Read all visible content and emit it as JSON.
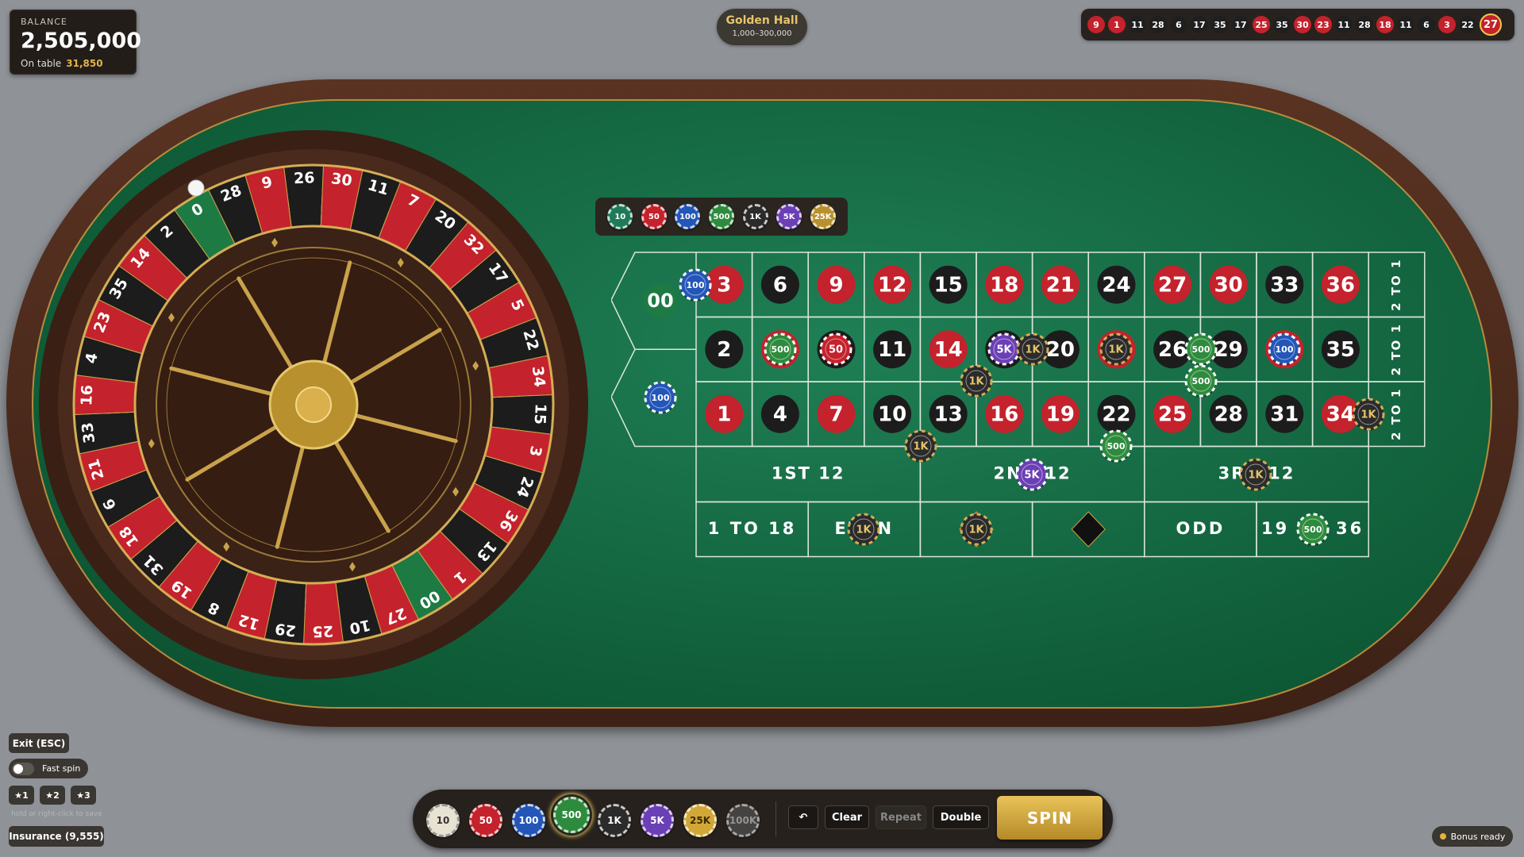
{
  "balance": {
    "label": "BALANCE",
    "amount": "2,505,000",
    "on_table_label": "On table",
    "on_table_value": "31,850"
  },
  "room": {
    "name": "Golden Hall",
    "limits": "1,000–300,000"
  },
  "history": [
    {
      "n": "9",
      "c": "red"
    },
    {
      "n": "1",
      "c": "red"
    },
    {
      "n": "11",
      "c": "black"
    },
    {
      "n": "28",
      "c": "black"
    },
    {
      "n": "6",
      "c": "black"
    },
    {
      "n": "17",
      "c": "black"
    },
    {
      "n": "35",
      "c": "black"
    },
    {
      "n": "17",
      "c": "black"
    },
    {
      "n": "25",
      "c": "red"
    },
    {
      "n": "35",
      "c": "black"
    },
    {
      "n": "30",
      "c": "red"
    },
    {
      "n": "23",
      "c": "red"
    },
    {
      "n": "11",
      "c": "black"
    },
    {
      "n": "28",
      "c": "black"
    },
    {
      "n": "18",
      "c": "red"
    },
    {
      "n": "11",
      "c": "black"
    },
    {
      "n": "6",
      "c": "black"
    },
    {
      "n": "3",
      "c": "red"
    },
    {
      "n": "22",
      "c": "black"
    },
    {
      "n": "27",
      "c": "red"
    }
  ],
  "wheel": {
    "pockets": [
      {
        "n": "0",
        "c": "green"
      },
      {
        "n": "28",
        "c": "black"
      },
      {
        "n": "9",
        "c": "red"
      },
      {
        "n": "26",
        "c": "black"
      },
      {
        "n": "30",
        "c": "red"
      },
      {
        "n": "11",
        "c": "black"
      },
      {
        "n": "7",
        "c": "red"
      },
      {
        "n": "20",
        "c": "black"
      },
      {
        "n": "32",
        "c": "red"
      },
      {
        "n": "17",
        "c": "black"
      },
      {
        "n": "5",
        "c": "red"
      },
      {
        "n": "22",
        "c": "black"
      },
      {
        "n": "34",
        "c": "red"
      },
      {
        "n": "15",
        "c": "black"
      },
      {
        "n": "3",
        "c": "red"
      },
      {
        "n": "24",
        "c": "black"
      },
      {
        "n": "36",
        "c": "red"
      },
      {
        "n": "13",
        "c": "black"
      },
      {
        "n": "1",
        "c": "red"
      },
      {
        "n": "00",
        "c": "green"
      },
      {
        "n": "27",
        "c": "red"
      },
      {
        "n": "10",
        "c": "black"
      },
      {
        "n": "25",
        "c": "red"
      },
      {
        "n": "29",
        "c": "black"
      },
      {
        "n": "12",
        "c": "red"
      },
      {
        "n": "8",
        "c": "black"
      },
      {
        "n": "19",
        "c": "red"
      },
      {
        "n": "31",
        "c": "black"
      },
      {
        "n": "18",
        "c": "red"
      },
      {
        "n": "6",
        "c": "black"
      },
      {
        "n": "21",
        "c": "red"
      },
      {
        "n": "33",
        "c": "black"
      },
      {
        "n": "16",
        "c": "red"
      },
      {
        "n": "4",
        "c": "black"
      },
      {
        "n": "23",
        "c": "red"
      },
      {
        "n": "35",
        "c": "black"
      },
      {
        "n": "14",
        "c": "red"
      },
      {
        "n": "2",
        "c": "black"
      }
    ]
  },
  "rack_chips": [
    {
      "label": "10",
      "color": "#1f7a5a"
    },
    {
      "label": "50",
      "color": "#c4222c"
    },
    {
      "label": "100",
      "color": "#2456b8"
    },
    {
      "label": "500",
      "color": "#2e8b3d"
    },
    {
      "label": "1K",
      "color": "#2b2b2b"
    },
    {
      "label": "5K",
      "color": "#6b3fb5"
    },
    {
      "label": "25K",
      "color": "#b8912e"
    }
  ],
  "board": {
    "zeros": [
      "00",
      "0"
    ],
    "rows": [
      [
        {
          "n": "3",
          "c": "red"
        },
        {
          "n": "6",
          "c": "black"
        },
        {
          "n": "9",
          "c": "red"
        },
        {
          "n": "12",
          "c": "red"
        },
        {
          "n": "15",
          "c": "black"
        },
        {
          "n": "18",
          "c": "red"
        },
        {
          "n": "21",
          "c": "red"
        },
        {
          "n": "24",
          "c": "black"
        },
        {
          "n": "27",
          "c": "red"
        },
        {
          "n": "30",
          "c": "red"
        },
        {
          "n": "33",
          "c": "black"
        },
        {
          "n": "36",
          "c": "red"
        }
      ],
      [
        {
          "n": "2",
          "c": "black"
        },
        {
          "n": "5",
          "c": "red"
        },
        {
          "n": "8",
          "c": "black"
        },
        {
          "n": "11",
          "c": "black"
        },
        {
          "n": "14",
          "c": "red"
        },
        {
          "n": "17",
          "c": "black"
        },
        {
          "n": "20",
          "c": "black"
        },
        {
          "n": "23",
          "c": "red"
        },
        {
          "n": "26",
          "c": "black"
        },
        {
          "n": "29",
          "c": "black"
        },
        {
          "n": "32",
          "c": "red"
        },
        {
          "n": "35",
          "c": "black"
        }
      ],
      [
        {
          "n": "1",
          "c": "red"
        },
        {
          "n": "4",
          "c": "black"
        },
        {
          "n": "7",
          "c": "red"
        },
        {
          "n": "10",
          "c": "black"
        },
        {
          "n": "13",
          "c": "black"
        },
        {
          "n": "16",
          "c": "red"
        },
        {
          "n": "19",
          "c": "red"
        },
        {
          "n": "22",
          "c": "black"
        },
        {
          "n": "25",
          "c": "red"
        },
        {
          "n": "28",
          "c": "black"
        },
        {
          "n": "31",
          "c": "black"
        },
        {
          "n": "34",
          "c": "red"
        }
      ]
    ],
    "column_bets": [
      "2 TO 1",
      "2 TO 1",
      "2 TO 1"
    ],
    "dozens": [
      "1ST 12",
      "2ND 12",
      "3RD 12"
    ],
    "outside": [
      "1 TO 18",
      "EVEN",
      "RED",
      "BLACK",
      "ODD",
      "19 TO 36"
    ]
  },
  "placed_chips": [
    {
      "id": "chip-00-top",
      "label": "100",
      "color": "#2456b8"
    },
    {
      "id": "chip-zero",
      "label": "100",
      "color": "#2456b8"
    },
    {
      "id": "chip-5",
      "label": "500",
      "color": "#2e8b3d"
    },
    {
      "id": "chip-8",
      "label": "50",
      "color": "#c4222c"
    },
    {
      "id": "chip-17",
      "label": "5K",
      "color": "#6b3fb5"
    },
    {
      "id": "chip-17-20",
      "label": "1K",
      "color": "#2b2b2b"
    },
    {
      "id": "chip-23",
      "label": "1K",
      "color": "#2b2b2b"
    },
    {
      "id": "chip-26-29",
      "label": "500",
      "color": "#2e8b3d"
    },
    {
      "id": "chip-32",
      "label": "100",
      "color": "#2456b8"
    },
    {
      "id": "chip-corner-13",
      "label": "1K",
      "color": "#2b2b2b"
    },
    {
      "id": "chip-corner-26",
      "label": "500",
      "color": "#2e8b3d"
    },
    {
      "id": "chip-col-1",
      "label": "1K",
      "color": "#2b2b2b"
    },
    {
      "id": "chip-street-10",
      "label": "1K",
      "color": "#2b2b2b"
    },
    {
      "id": "chip-street-22",
      "label": "500",
      "color": "#2e8b3d"
    },
    {
      "id": "chip-2nd12",
      "label": "5K",
      "color": "#6b3fb5"
    },
    {
      "id": "chip-3rd12",
      "label": "1K",
      "color": "#2b2b2b"
    },
    {
      "id": "chip-even",
      "label": "1K",
      "color": "#2b2b2b"
    },
    {
      "id": "chip-red",
      "label": "1K",
      "color": "#2b2b2b"
    },
    {
      "id": "chip-19to36",
      "label": "500",
      "color": "#2e8b3d"
    }
  ],
  "controls": {
    "exit": "Exit (ESC)",
    "fast_spin": "Fast spin",
    "slots": [
      "★1",
      "★2",
      "★3"
    ],
    "slot_hint": "hold or right-click to save",
    "insurance": "Insurance (9,555)",
    "bonus": "Bonus ready",
    "undo_icon": "undo-icon",
    "clear": "Clear",
    "repeat": "Repeat",
    "double": "Double",
    "spin": "SPIN"
  },
  "tray_chips": [
    {
      "label": "10",
      "color": "#e8e2d2",
      "text": "#333"
    },
    {
      "label": "50",
      "color": "#c4222c",
      "text": "#fff"
    },
    {
      "label": "100",
      "color": "#2456b8",
      "text": "#fff"
    },
    {
      "label": "500",
      "color": "#2e8b3d",
      "text": "#fff",
      "selected": true
    },
    {
      "label": "1K",
      "color": "#2b2b2b",
      "text": "#fff"
    },
    {
      "label": "5K",
      "color": "#6b3fb5",
      "text": "#fff"
    },
    {
      "label": "25K",
      "color": "#d1a838",
      "text": "#3a2a00"
    },
    {
      "label": "100K",
      "color": "#4f4f4f",
      "text": "#bbb",
      "locked": true
    }
  ]
}
